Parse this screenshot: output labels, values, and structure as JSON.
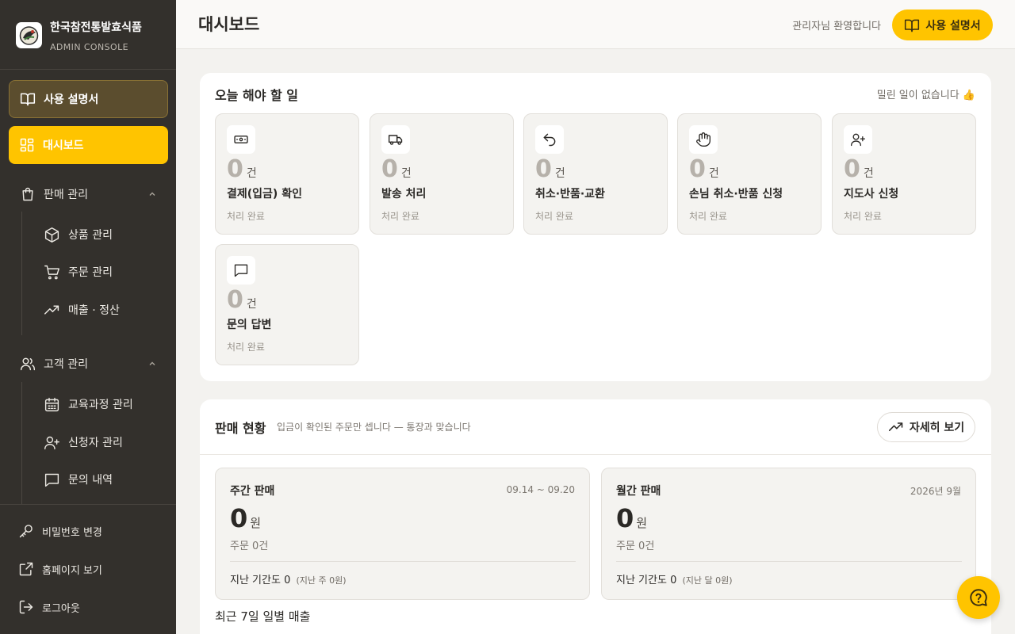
{
  "brand": {
    "name": "한국참전통발효식품",
    "subtitle": "ADMIN CONSOLE"
  },
  "sidebar": {
    "manual_label": "사용 설명서",
    "dashboard_label": "대시보드",
    "groups": [
      {
        "label": "판매 관리",
        "icon": "shopping-bag-icon",
        "items": [
          {
            "label": "상품 관리",
            "icon": "package-icon"
          },
          {
            "label": "주문 관리",
            "icon": "cart-icon"
          },
          {
            "label": "매출 · 정산",
            "icon": "trending-up-icon"
          }
        ]
      },
      {
        "label": "고객 관리",
        "icon": "users-icon",
        "items": [
          {
            "label": "교육과정 관리",
            "icon": "calendar-icon"
          },
          {
            "label": "신청자 관리",
            "icon": "user-plus-icon"
          },
          {
            "label": "문의 내역",
            "icon": "message-icon"
          }
        ]
      }
    ],
    "bottom": [
      {
        "label": "비밀번호 변경",
        "icon": "key-icon"
      },
      {
        "label": "홈페이지 보기",
        "icon": "external-link-icon"
      },
      {
        "label": "로그아웃",
        "icon": "logout-icon"
      }
    ]
  },
  "header": {
    "title": "대시보드",
    "welcome": "관리자님 환영합니다",
    "manual_button": "사용 설명서"
  },
  "todo": {
    "title": "오늘 해야 할 일",
    "note": "밀린 일이 없습니다 👍",
    "tasks": [
      {
        "count": "0",
        "unit": "건",
        "label": "결제(입금) 확인",
        "status": "처리 완료",
        "icon": "cash-icon"
      },
      {
        "count": "0",
        "unit": "건",
        "label": "발송 처리",
        "status": "처리 완료",
        "icon": "truck-icon"
      },
      {
        "count": "0",
        "unit": "건",
        "label": "취소·반품·교환",
        "status": "처리 완료",
        "icon": "undo-icon"
      },
      {
        "count": "0",
        "unit": "건",
        "label": "손님 취소·반품 신청",
        "status": "처리 완료",
        "icon": "hand-icon"
      },
      {
        "count": "0",
        "unit": "건",
        "label": "지도사 신청",
        "status": "처리 완료",
        "icon": "user-plus-icon"
      },
      {
        "count": "0",
        "unit": "건",
        "label": "문의 답변",
        "status": "처리 완료",
        "icon": "message-icon"
      }
    ]
  },
  "sales": {
    "title": "판매 현황",
    "subtitle": "입금이 확인된 주문만 셉니다 — 통장과 맞습니다",
    "detail_button": "자세히 보기",
    "weekly": {
      "title": "주간 판매",
      "range": "09.14 ~ 09.20",
      "amount": "0",
      "unit": "원",
      "orders": "주문 0건",
      "prev": "지난 기간도 0",
      "prev_note": "(지난 주 0원)"
    },
    "monthly": {
      "title": "월간 판매",
      "range": "2026년 9월",
      "amount": "0",
      "unit": "원",
      "orders": "주문 0건",
      "prev": "지난 기간도 0",
      "prev_note": "(지난 달 0원)"
    },
    "daily_title": "최근 7일 일별 매출"
  },
  "colors": {
    "accent": "#ffc400",
    "sidebar_bg": "#33302c",
    "page_bg": "#f3f2ef"
  }
}
